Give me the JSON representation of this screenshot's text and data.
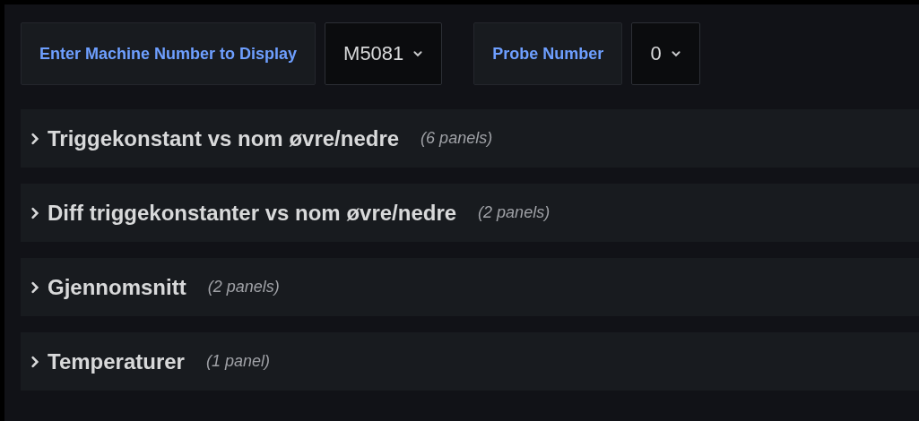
{
  "variables": [
    {
      "label": "Enter Machine Number to Display",
      "value": "M5081"
    },
    {
      "label": "Probe Number",
      "value": "0"
    }
  ],
  "rows": [
    {
      "title": "Triggekonstant vs nom øvre/nedre",
      "count": "(6 panels)",
      "expanded": false
    },
    {
      "title": "Diff triggekonstanter vs nom øvre/nedre",
      "count": "(2 panels)",
      "expanded": false
    },
    {
      "title": "Gjennomsnitt",
      "count": "(2 panels)",
      "expanded": false
    },
    {
      "title": "Temperaturer",
      "count": "(1 panel)",
      "expanded": false
    }
  ]
}
